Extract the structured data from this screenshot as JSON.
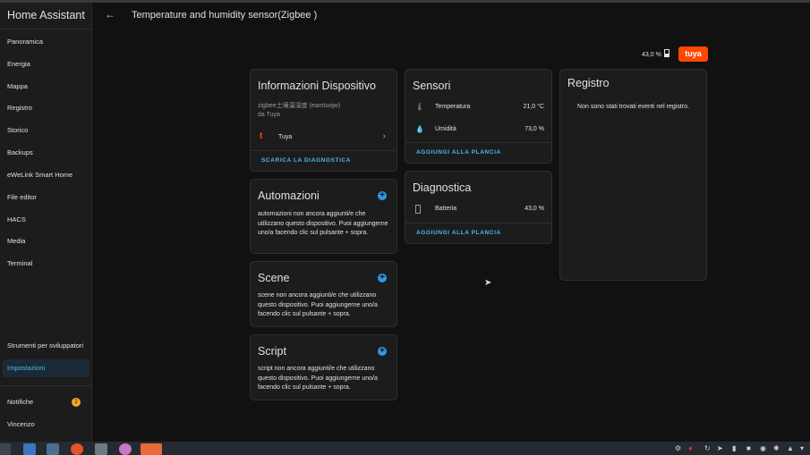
{
  "app": {
    "title": "Home Assistant"
  },
  "sidebar": {
    "items": [
      {
        "label": "Panoramica"
      },
      {
        "label": "Energia"
      },
      {
        "label": "Mappa"
      },
      {
        "label": "Registro"
      },
      {
        "label": "Storico"
      },
      {
        "label": "Backups"
      },
      {
        "label": "eWeLink Smart Home"
      },
      {
        "label": "File editor"
      },
      {
        "label": "HACS"
      },
      {
        "label": "Media"
      },
      {
        "label": "Terminal"
      }
    ],
    "developer_tools": "Strumenti per sviluppatori",
    "settings": "Impostazioni",
    "notifications": "Notifiche",
    "notifications_badge": "2",
    "user": "Vincenzo"
  },
  "header": {
    "back_icon": "arrow-left-icon",
    "title": "Temperature and humidity sensor(Zigbee )"
  },
  "battery_header": {
    "value": "43,0 %",
    "brand": "tuya"
  },
  "device_info": {
    "title": "Informazioni Dispositivo",
    "model": "zigbee土壤温湿度 (eamtuojw)",
    "manufacturer": "da Tuya",
    "integration": "Tuya",
    "download_link": "SCARICA LA DIAGNOSTICA"
  },
  "automations": {
    "title": "Automazioni",
    "text": "automazioni non ancora aggiunti/e che utilizzano questo dispositivo. Puoi aggiungerne uno/a facendo clic sul pulsante + sopra."
  },
  "scenes": {
    "title": "Scene",
    "text": "scene non ancora aggiunti/e che utilizzano questo dispositivo. Puoi aggiungerne uno/a facendo clic sul pulsante + sopra."
  },
  "scripts": {
    "title": "Script",
    "text": "script non ancora aggiunti/e che utilizzano questo dispositivo. Puoi aggiungerne uno/a facendo clic sul pulsante + sopra."
  },
  "sensors": {
    "title": "Sensori",
    "rows": [
      {
        "label": "Temperatura",
        "value": "21,0 °C",
        "icon": "thermometer-icon"
      },
      {
        "label": "Umidità",
        "value": "73,0 %",
        "icon": "water-drop-icon"
      }
    ],
    "add_link": "AGGIUNGI ALLA PLANCIA"
  },
  "diagnostics": {
    "title": "Diagnostica",
    "rows": [
      {
        "label": "Batteria",
        "value": "43,0 %",
        "icon": "battery-icon"
      }
    ],
    "add_link": "AGGIUNGI ALLA PLANCIA"
  },
  "logbook": {
    "title": "Registro",
    "empty": "Non sono stati trovati eventi nel registro."
  },
  "colors": {
    "accent": "#4fb8f0",
    "plus": "#2d9be6",
    "tuya": "#ff4800",
    "card": "#1c1c1c",
    "background": "#111111",
    "badge": "#f5a623"
  }
}
